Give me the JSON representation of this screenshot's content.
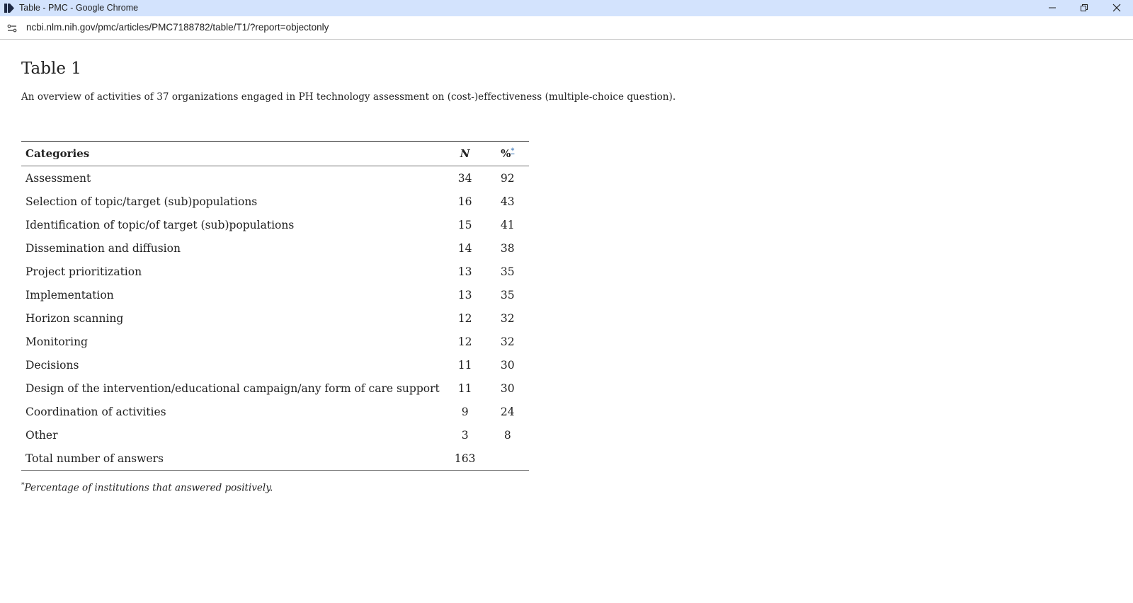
{
  "window": {
    "title": "Table - PMC - Google Chrome"
  },
  "address_bar": {
    "url": "ncbi.nlm.nih.gov/pmc/articles/PMC7188782/table/T1/?report=objectonly"
  },
  "page": {
    "title": "Table 1",
    "caption": "An overview of activities of 37 organizations engaged in PH technology assessment on (cost-)effectiveness (multiple-choice question)."
  },
  "table": {
    "headers": {
      "category": "Categories",
      "n": "N",
      "percent": "%",
      "percent_footnote_marker": "*"
    },
    "rows": [
      {
        "category": "Assessment",
        "n": "34",
        "percent": "92"
      },
      {
        "category": "Selection of topic/target (sub)populations",
        "n": "16",
        "percent": "43"
      },
      {
        "category": "Identification of topic/of target (sub)populations",
        "n": "15",
        "percent": "41"
      },
      {
        "category": "Dissemination and diffusion",
        "n": "14",
        "percent": "38"
      },
      {
        "category": "Project prioritization",
        "n": "13",
        "percent": "35"
      },
      {
        "category": "Implementation",
        "n": "13",
        "percent": "35"
      },
      {
        "category": "Horizon scanning",
        "n": "12",
        "percent": "32"
      },
      {
        "category": "Monitoring",
        "n": "12",
        "percent": "32"
      },
      {
        "category": "Decisions",
        "n": "11",
        "percent": "30"
      },
      {
        "category": "Design of the intervention/educational campaign/any form of care support",
        "n": "11",
        "percent": "30"
      },
      {
        "category": "Coordination of activities",
        "n": "9",
        "percent": "24"
      },
      {
        "category": "Other",
        "n": "3",
        "percent": "8"
      },
      {
        "category": "Total number of answers",
        "n": "163",
        "percent": ""
      }
    ]
  },
  "footnote": {
    "marker": "*",
    "text": "Percentage of institutions that answered positively."
  },
  "icons": {
    "app": "chrome-app-icon",
    "site_info": "site-info-icon",
    "minimize": "minimize-icon",
    "maximize": "restore-icon",
    "close": "close-icon"
  },
  "colors": {
    "titlebar_bg": "#d3e3fd",
    "text": "#212121",
    "link": "#2f6fb5"
  }
}
